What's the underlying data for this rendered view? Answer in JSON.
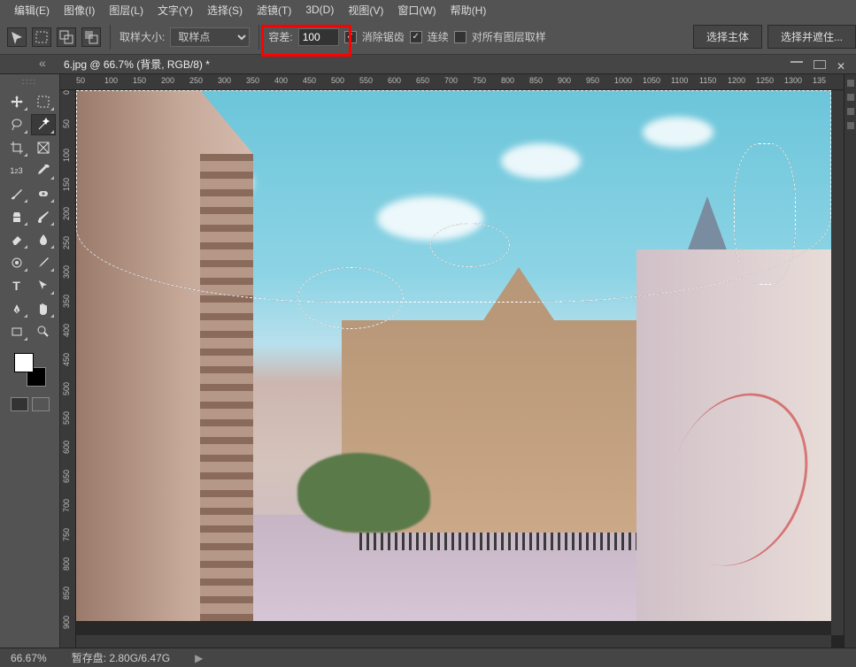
{
  "menu": {
    "items": [
      "编辑(E)",
      "图像(I)",
      "图层(L)",
      "文字(Y)",
      "选择(S)",
      "滤镜(T)",
      "3D(D)",
      "视图(V)",
      "窗口(W)",
      "帮助(H)"
    ]
  },
  "options": {
    "sampleSizeLabel": "取样大小:",
    "sampleSizeValue": "取样点",
    "toleranceLabel": "容差:",
    "toleranceValue": "100",
    "antiAliasLabel": "消除锯齿",
    "contiguousLabel": "连续",
    "allLayersLabel": "对所有图层取样",
    "selectSubject": "选择主体",
    "selectMask": "选择并遮住..."
  },
  "tab": {
    "title": "6.jpg @ 66.7% (背景, RGB/8) *"
  },
  "rulerH": [
    "50",
    "100",
    "150",
    "200",
    "250",
    "300",
    "350",
    "400",
    "450",
    "500",
    "550",
    "600",
    "650",
    "700",
    "750",
    "800",
    "850",
    "900",
    "950",
    "1000",
    "1050",
    "1100",
    "1150",
    "1200",
    "1250",
    "1300",
    "135"
  ],
  "rulerV": [
    "0",
    "50",
    "100",
    "150",
    "200",
    "250",
    "300",
    "350",
    "400",
    "450",
    "500",
    "550",
    "600",
    "650",
    "700",
    "750",
    "800",
    "850",
    "900"
  ],
  "status": {
    "zoom": "66.67%",
    "scratch": "暂存盘: 2.80G/6.47G"
  },
  "tools": {
    "move": "移",
    "wand": "wand",
    "lasso": "套",
    "quick": "□",
    "crop": "裁",
    "frame": "框",
    "num": "123",
    "eyedrop": "吸",
    "brush": "笔",
    "heal": "补",
    "clone": "章",
    "replace": "替",
    "eraser": "橡",
    "blur": "滴",
    "history": "史",
    "smudge": "涂",
    "type": "T",
    "path": "↖",
    "pen": "✒",
    "hand": "✋",
    "shape": "▭",
    "zoom": "🔍"
  }
}
